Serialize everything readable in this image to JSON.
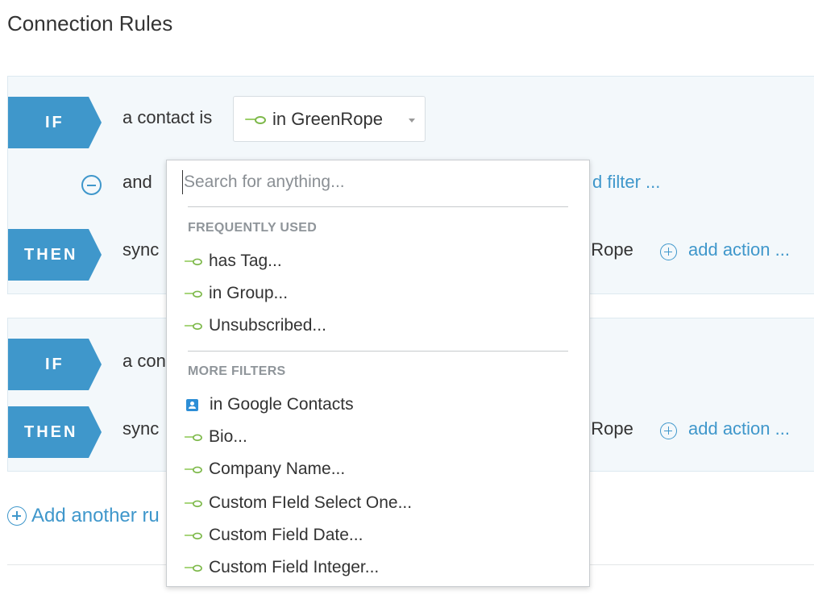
{
  "page": {
    "title": "Connection Rules"
  },
  "rule1": {
    "if_label": "IF",
    "if_text": "a contact is",
    "selected_source": "in GreenRope",
    "and_label": "and",
    "add_filter_label": "d filter ...",
    "then_label": "THEN",
    "then_text": "sync",
    "then_target_tail": "nRope",
    "add_action_label": "add action ..."
  },
  "rule2": {
    "if_label": "IF",
    "if_text": "a con",
    "then_label": "THEN",
    "then_text": "sync",
    "then_target_tail": "nRope",
    "add_action_label": "add action ..."
  },
  "add_rule_label": "Add another ru",
  "dropdown": {
    "search_placeholder": "Search for anything...",
    "frequently_used_header": "FREQUENTLY USED",
    "frequently_used": [
      {
        "label": "has Tag...",
        "icon": "greenrope-icon"
      },
      {
        "label": "in Group...",
        "icon": "greenrope-icon"
      },
      {
        "label": "Unsubscribed...",
        "icon": "greenrope-icon"
      }
    ],
    "more_filters_header": "MORE FILTERS",
    "more_filters": [
      {
        "label": "in Google Contacts",
        "icon": "google-contacts-icon"
      },
      {
        "label": "Bio...",
        "icon": "greenrope-icon"
      },
      {
        "label": "Company Name...",
        "icon": "greenrope-icon"
      },
      {
        "label": "Custom FIeld Select One...",
        "icon": "greenrope-icon"
      },
      {
        "label": "Custom Field Date...",
        "icon": "greenrope-icon"
      },
      {
        "label": "Custom Field Integer...",
        "icon": "greenrope-icon"
      }
    ]
  },
  "colors": {
    "accent": "#3f97cb",
    "rule_bg": "#f3f8fb",
    "greenrope": "#7db84a",
    "google_contacts": "#2d8ed6"
  }
}
